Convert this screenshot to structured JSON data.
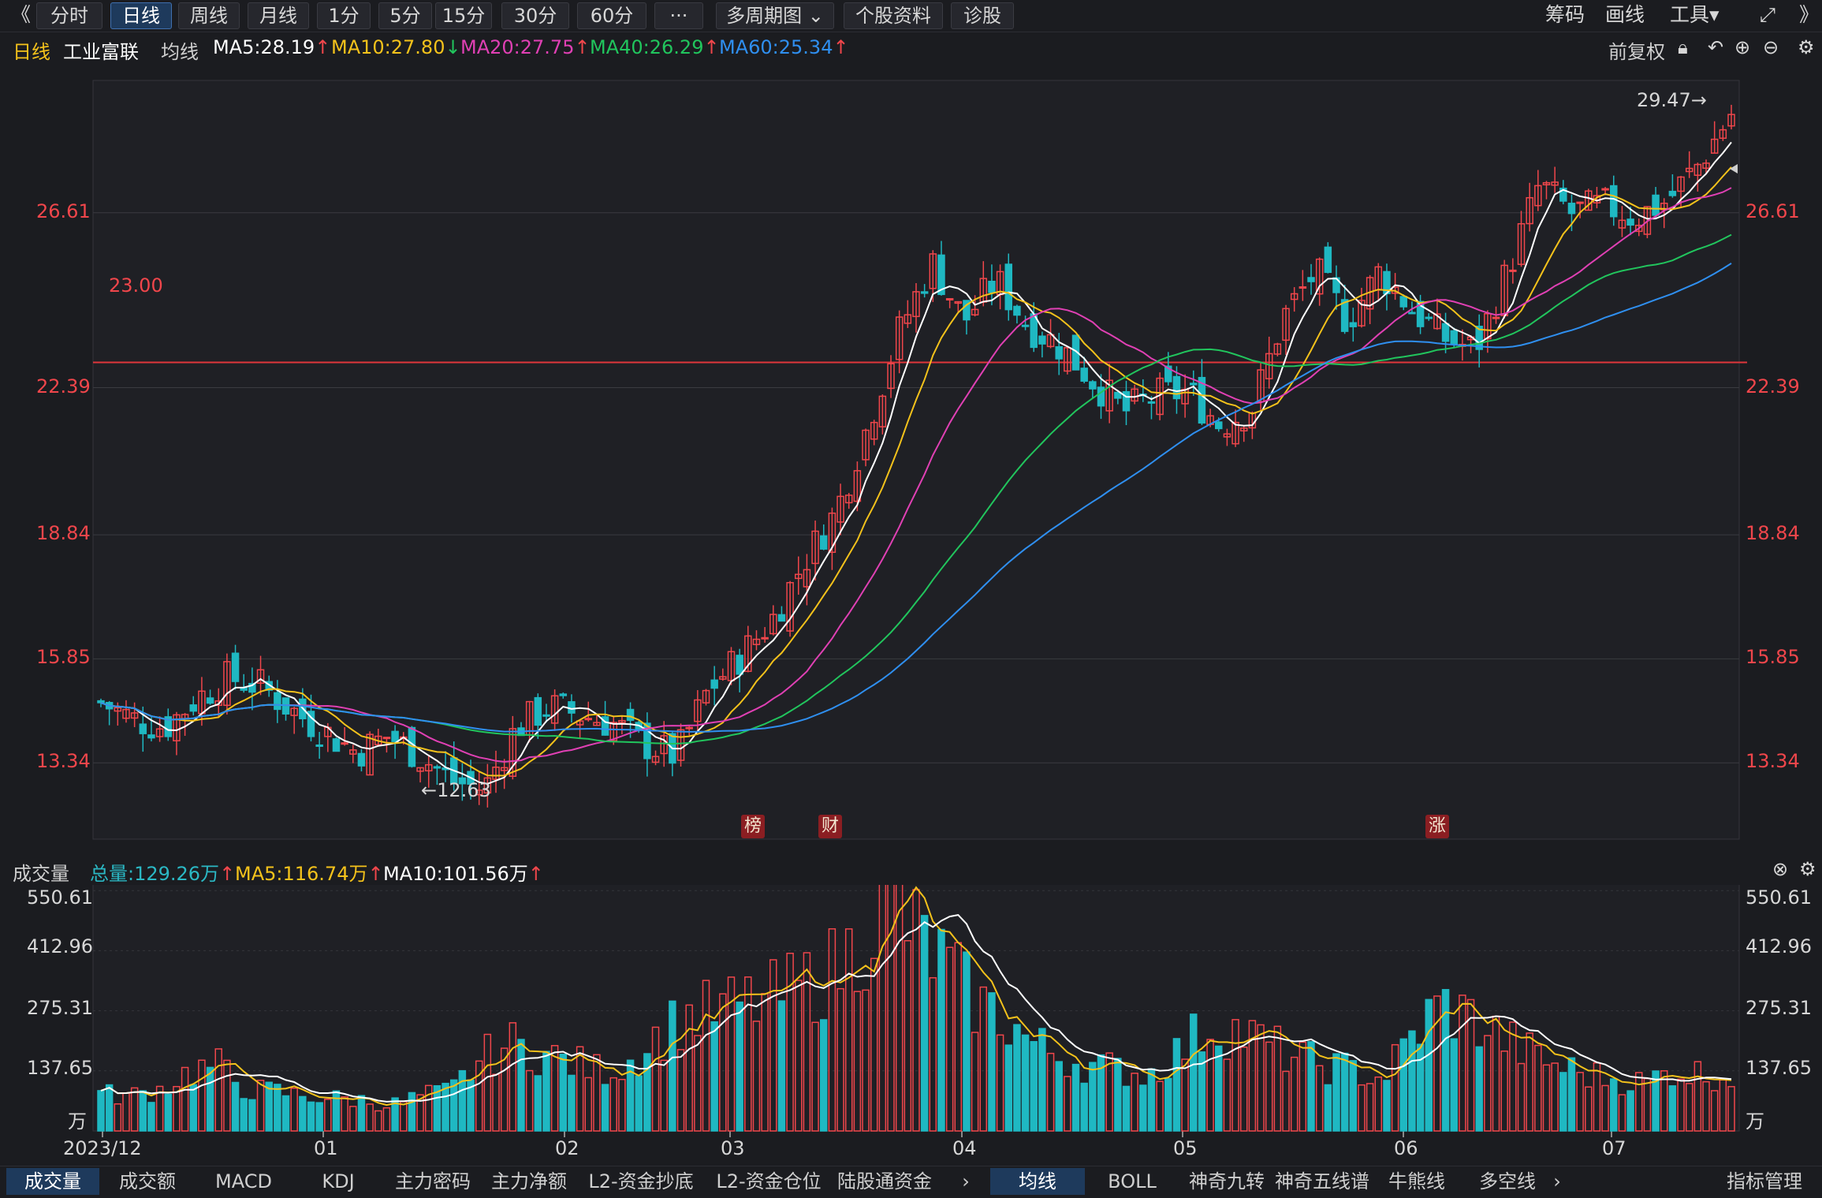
{
  "toolbar": {
    "collapse_icon": "double-chevron-left-icon",
    "periods": [
      "分时",
      "日线",
      "周线",
      "月线",
      "1分",
      "5分",
      "15分",
      "30分",
      "60分",
      "···"
    ],
    "active_period": "日线",
    "multi_period": "多周期图",
    "stock_info": "个股资料",
    "diagnose": "诊股",
    "right": [
      "筹码",
      "画线",
      "工具"
    ],
    "expand_icon": "fullscreen-icon",
    "more_icon": "double-chevron-right-icon"
  },
  "ma_bar": {
    "period": "日线",
    "stock": "工业富联",
    "avg_label": "均线",
    "ma5": "MA5:28.19",
    "ma10": "MA10:27.80",
    "ma20": "MA20:27.75",
    "ma40": "MA40:26.29",
    "ma60": "MA60:25.34",
    "adjust": "前复权",
    "colors": {
      "ma5": "#ffffff",
      "ma10": "#f4c21b",
      "ma20": "#e040b4",
      "ma40": "#21c55d",
      "ma60": "#2f8ff0"
    }
  },
  "price_axis": {
    "labels": [
      "26.61",
      "22.39",
      "18.84",
      "15.85",
      "13.34"
    ]
  },
  "annotations": {
    "hline": "23.00",
    "high": "29.47→",
    "low": "←12.63",
    "badges": [
      "榜",
      "财",
      "涨"
    ]
  },
  "volume_bar": {
    "title": "成交量",
    "total": "总量:129.26万",
    "ma5": "MA5:116.74万",
    "ma10": "MA10:101.56万"
  },
  "volume_axis": {
    "labels": [
      "550.61",
      "412.96",
      "275.31",
      "137.65",
      "万"
    ]
  },
  "time_axis": {
    "labels": [
      "2023/12",
      "01",
      "02",
      "03",
      "04",
      "05",
      "06",
      "07"
    ]
  },
  "tabs_left": [
    "成交量",
    "成交额",
    "MACD",
    "KDJ",
    "主力密码",
    "主力净额",
    "L2-资金抄底",
    "L2-资金仓位",
    "陆股通资金"
  ],
  "tabs_left_active": "成交量",
  "tabs_right": [
    "均线",
    "BOLL",
    "神奇九转",
    "神奇五线谱",
    "牛熊线",
    "多空线"
  ],
  "tabs_right_active": "均线",
  "indicator_manage": "指标管理",
  "chart_data": [
    {
      "type": "candlestick",
      "title": "工业富联 日线",
      "xlabel": "",
      "ylabel": "",
      "x_ticks": [
        "2023/12",
        "01",
        "02",
        "03",
        "04",
        "05",
        "06",
        "07"
      ],
      "y_ticks": [
        13.34,
        15.85,
        18.84,
        22.39,
        26.61
      ],
      "ylim": [
        11.5,
        29.8
      ],
      "hline": 23.0,
      "series": [
        {
          "name": "MA5",
          "values": [
            28.19
          ]
        },
        {
          "name": "MA10",
          "values": [
            27.8
          ]
        },
        {
          "name": "MA20",
          "values": [
            27.75
          ]
        },
        {
          "name": "MA40",
          "values": [
            26.29
          ]
        },
        {
          "name": "MA60",
          "values": [
            25.34
          ]
        }
      ],
      "close_path": [
        14.8,
        14.4,
        14.2,
        14.9,
        15.4,
        15.2,
        14.6,
        14.1,
        13.6,
        14.0,
        13.5,
        12.9,
        12.7,
        14.2,
        14.7,
        14.5,
        14.3,
        13.8,
        13.5,
        15.1,
        15.9,
        16.8,
        18.2,
        19.4,
        21.5,
        23.8,
        25.4,
        24.0,
        25.0,
        23.9,
        23.4,
        22.6,
        21.8,
        22.2,
        22.3,
        21.5,
        21.9,
        24.1,
        25.2,
        24.0,
        25.2,
        24.3,
        23.6,
        23.3,
        25.2,
        27.3,
        26.6,
        26.8,
        26.5,
        26.9,
        27.8,
        29.0
      ],
      "annotations": {
        "high": 29.47,
        "low": 12.63
      }
    },
    {
      "type": "bar",
      "title": "成交量",
      "unit": "万",
      "y_ticks": [
        137.65,
        275.31,
        412.96,
        550.61
      ],
      "ylim": [
        0,
        560
      ],
      "series": [
        {
          "name": "总量",
          "values": [
            129.26
          ]
        },
        {
          "name": "MA5",
          "values": [
            116.74
          ]
        },
        {
          "name": "MA10",
          "values": [
            101.56
          ]
        }
      ],
      "volume_path": [
        85,
        80,
        95,
        135,
        150,
        95,
        90,
        80,
        75,
        70,
        60,
        80,
        90,
        160,
        200,
        180,
        160,
        140,
        150,
        210,
        260,
        270,
        290,
        300,
        330,
        360,
        420,
        550,
        450,
        380,
        300,
        260,
        200,
        170,
        150,
        140,
        130,
        180,
        240,
        230,
        200,
        170,
        150,
        140,
        120,
        210,
        290,
        260,
        220,
        180,
        150,
        130,
        120,
        110,
        140,
        130,
        129
      ]
    }
  ]
}
